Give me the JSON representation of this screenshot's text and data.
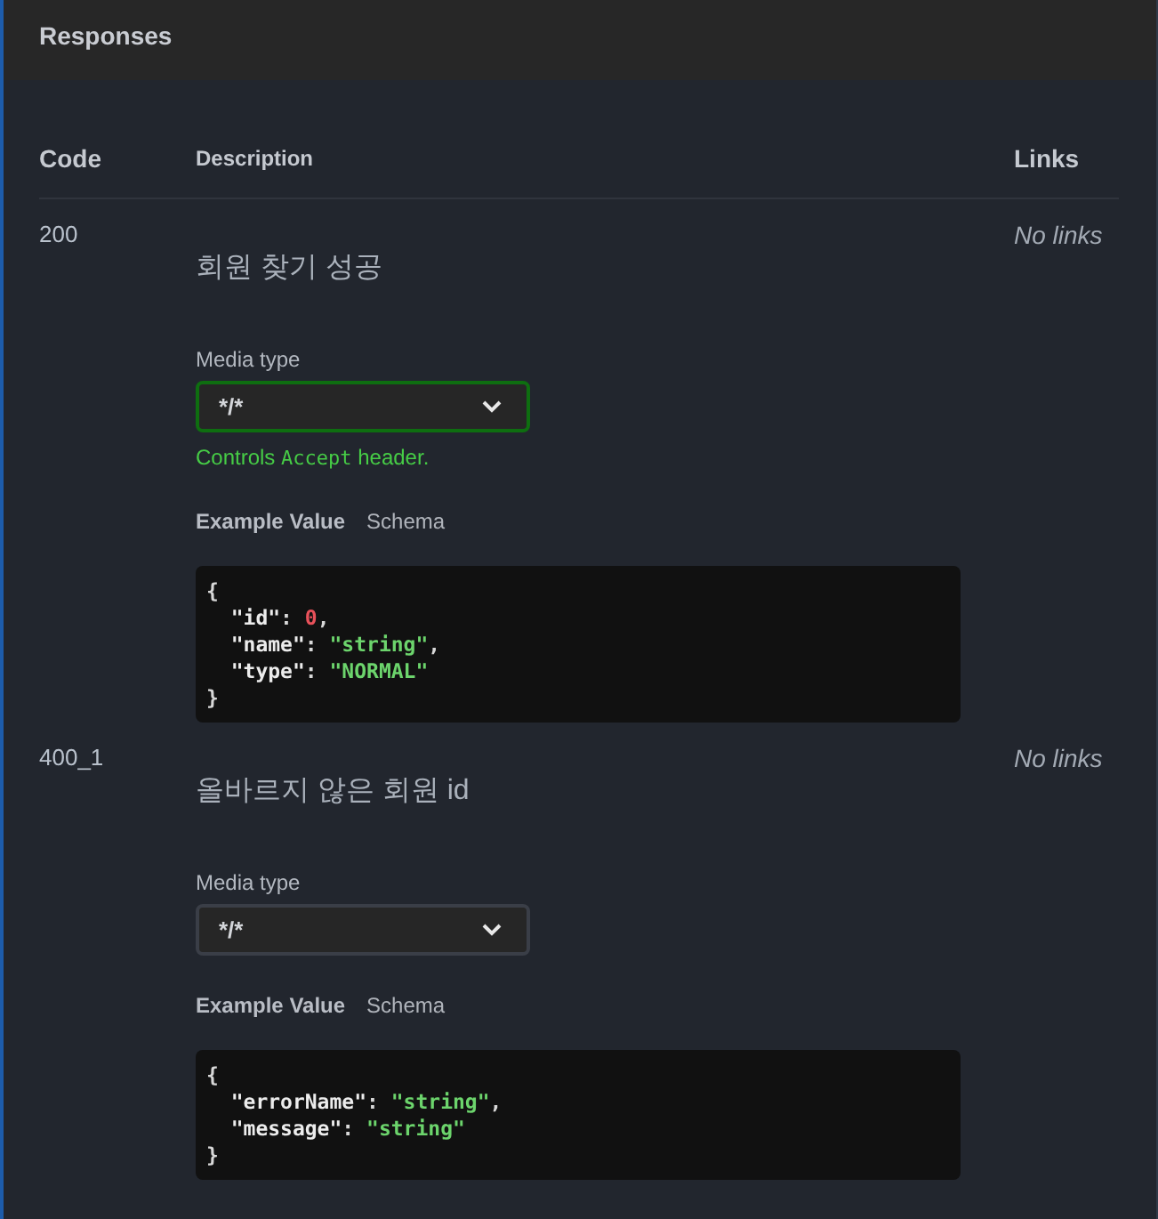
{
  "section": {
    "title": "Responses"
  },
  "table": {
    "columns": [
      "Code",
      "Description",
      "Links"
    ],
    "rows": [
      {
        "code": "200",
        "description": "회원 찾기 성공",
        "media_type_label": "Media type",
        "media_type": {
          "value": "*/*",
          "focused": true
        },
        "hint": [
          {
            "text": "Controls ",
            "kind": "plain"
          },
          {
            "text": "Accept",
            "kind": "code"
          },
          {
            "text": " header.",
            "kind": "plain"
          }
        ],
        "example_tabs": [
          {
            "label": "Example Value",
            "selected": true
          },
          {
            "label": "Schema",
            "selected": false
          }
        ],
        "example": [
          [
            {
              "text": "{",
              "kind": "punct"
            }
          ],
          [
            {
              "text": "  \"id\"",
              "kind": "key"
            },
            {
              "text": ": ",
              "kind": "punct"
            },
            {
              "text": "0",
              "kind": "number"
            },
            {
              "text": ",",
              "kind": "punct"
            }
          ],
          [
            {
              "text": "  \"name\"",
              "kind": "key"
            },
            {
              "text": ": ",
              "kind": "punct"
            },
            {
              "text": "\"string\"",
              "kind": "string"
            },
            {
              "text": ",",
              "kind": "punct"
            }
          ],
          [
            {
              "text": "  \"type\"",
              "kind": "key"
            },
            {
              "text": ": ",
              "kind": "punct"
            },
            {
              "text": "\"NORMAL\"",
              "kind": "string"
            }
          ],
          [
            {
              "text": "}",
              "kind": "punct"
            }
          ]
        ],
        "links": "No links"
      },
      {
        "code": "400_1",
        "description": "올바르지 않은 회원 id",
        "media_type_label": "Media type",
        "media_type": {
          "value": "*/*",
          "focused": false
        },
        "example_tabs": [
          {
            "label": "Example Value",
            "selected": true
          },
          {
            "label": "Schema",
            "selected": false
          }
        ],
        "example": [
          [
            {
              "text": "{",
              "kind": "punct"
            }
          ],
          [
            {
              "text": "  \"errorName\"",
              "kind": "key"
            },
            {
              "text": ": ",
              "kind": "punct"
            },
            {
              "text": "\"string\"",
              "kind": "string"
            },
            {
              "text": ",",
              "kind": "punct"
            }
          ],
          [
            {
              "text": "  \"message\"",
              "kind": "key"
            },
            {
              "text": ": ",
              "kind": "punct"
            },
            {
              "text": "\"string\"",
              "kind": "string"
            }
          ],
          [
            {
              "text": "}",
              "kind": "punct"
            }
          ]
        ],
        "links": "No links"
      }
    ]
  }
}
